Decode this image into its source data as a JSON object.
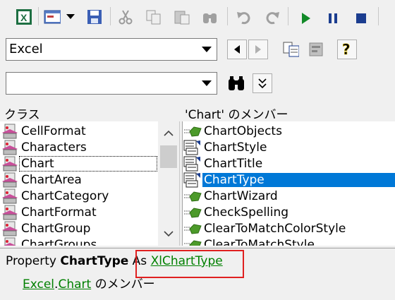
{
  "toolbar": {
    "icons": [
      "excel-icon",
      "userform-icon",
      "dropdown-arrow-icon",
      "save-icon",
      "cut-icon",
      "copy-icon",
      "paste-icon",
      "find-icon",
      "undo-icon",
      "redo-icon",
      "run-icon",
      "pause-icon",
      "stop-icon"
    ]
  },
  "library_combo": {
    "value": "Excel"
  },
  "search_combo": {
    "value": ""
  },
  "classes_pane": {
    "header": "クラス",
    "items": [
      "CellFormat",
      "Characters",
      "Chart",
      "ChartArea",
      "ChartCategory",
      "ChartFormat",
      "ChartGroup",
      "ChartGroups"
    ],
    "selected": "Chart"
  },
  "members_pane": {
    "header": "'Chart' のメンバー",
    "items": [
      {
        "label": "ChartObjects",
        "icon": "method-icon"
      },
      {
        "label": "ChartStyle",
        "icon": "property-icon"
      },
      {
        "label": "ChartTitle",
        "icon": "property-icon"
      },
      {
        "label": "ChartType",
        "icon": "property-icon"
      },
      {
        "label": "ChartWizard",
        "icon": "method-icon"
      },
      {
        "label": "CheckSpelling",
        "icon": "method-icon"
      },
      {
        "label": "ClearToMatchColorStyle",
        "icon": "method-icon"
      },
      {
        "label": "ClearToMatchStyle",
        "icon": "method-icon"
      }
    ],
    "selected": "ChartType"
  },
  "details": {
    "kind": "Property",
    "name": "ChartType",
    "as": "As",
    "type_link": "XlChartType",
    "lib_link": "Excel",
    "dot": ".",
    "class_link": "Chart",
    "member_of": "のメンバー"
  },
  "colors": {
    "selection": "#0078d7",
    "link": "#008000",
    "highlight_box": "#e02020"
  }
}
